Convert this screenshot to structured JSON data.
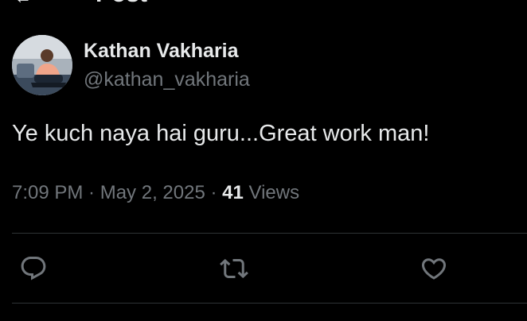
{
  "header": {
    "back_icon": "arrow-left-icon",
    "title": "Post"
  },
  "author": {
    "display_name": "Kathan Vakharia",
    "handle": "@kathan_vakharia",
    "avatar_icon": "avatar"
  },
  "post": {
    "text": "Ye kuch naya hai guru...Great work man!",
    "time": "7:09 PM",
    "separator1": " · ",
    "date": "May 2, 2025",
    "separator2": " · ",
    "views_count": "41",
    "views_label": " Views"
  },
  "actions": [
    {
      "name": "reply",
      "icon": "reply-icon"
    },
    {
      "name": "repost",
      "icon": "repost-icon"
    },
    {
      "name": "like",
      "icon": "heart-icon"
    }
  ],
  "colors": {
    "background": "#000000",
    "primary_text": "#e7e9ea",
    "secondary_text": "#71767b",
    "divider": "#2f3336"
  }
}
